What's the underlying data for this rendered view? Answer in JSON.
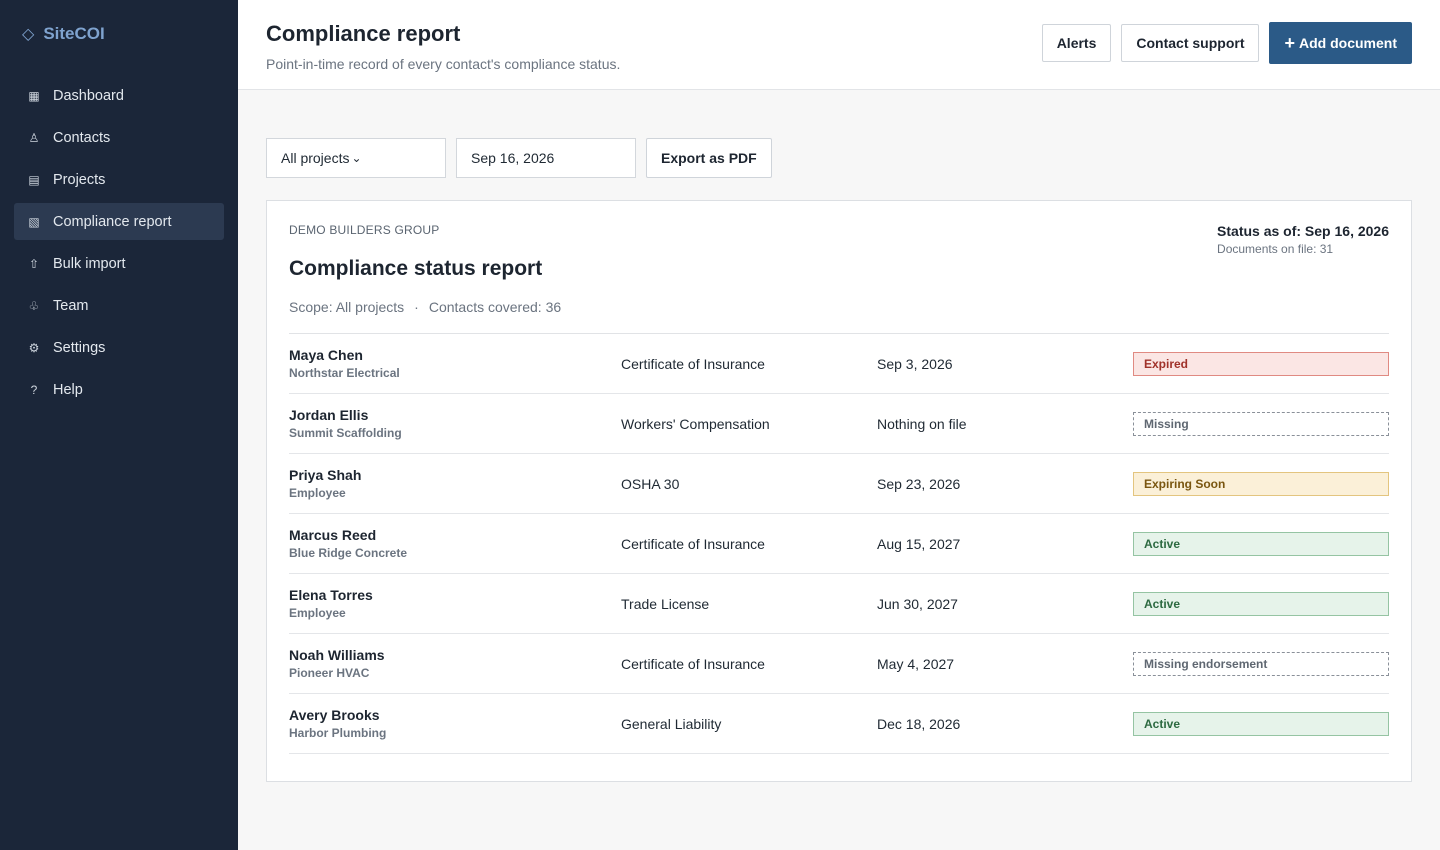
{
  "app": {
    "name": "SiteCOI",
    "logo_icon": "diamond-icon"
  },
  "sidebar": {
    "items": [
      {
        "label": "Dashboard",
        "icon": "grid-icon",
        "glyph": "▦",
        "active": false
      },
      {
        "label": "Contacts",
        "icon": "person-icon",
        "glyph": "♙",
        "active": false
      },
      {
        "label": "Projects",
        "icon": "list-icon",
        "glyph": "▤",
        "active": false
      },
      {
        "label": "Compliance report",
        "icon": "report-icon",
        "glyph": "▧",
        "active": true
      },
      {
        "label": "Bulk import",
        "icon": "upload-icon",
        "glyph": "⇧",
        "active": false
      },
      {
        "label": "Team",
        "icon": "team-icon",
        "glyph": "♧",
        "active": false
      },
      {
        "label": "Settings",
        "icon": "gear-icon",
        "glyph": "⚙",
        "active": false
      },
      {
        "label": "Help",
        "icon": "help-icon",
        "glyph": "?",
        "active": false
      }
    ]
  },
  "header": {
    "title": "Compliance report",
    "subtitle": "Point-in-time record of every contact's compliance status.",
    "alerts_label": "Alerts",
    "support_label": "Contact support",
    "add_label": "Add document"
  },
  "filters": {
    "project": "All projects",
    "date": "Sep 16, 2026",
    "export_label": "Export as PDF"
  },
  "report": {
    "org": "DEMO BUILDERS GROUP",
    "title": "Compliance status report",
    "status_as_of": "Status as of: Sep 16, 2026",
    "documents_on_file": "Documents on file: 31",
    "scope": "Scope: All projects",
    "separator": "·",
    "contacts_covered": "Contacts covered: 36",
    "rows": [
      {
        "name": "Maya Chen",
        "company": "Northstar Electrical",
        "document": "Certificate of Insurance",
        "date": "Sep 3, 2026",
        "status": "Expired",
        "status_kind": "expired"
      },
      {
        "name": "Jordan Ellis",
        "company": "Summit Scaffolding",
        "document": "Workers' Compensation",
        "date": "Nothing on file",
        "status": "Missing",
        "status_kind": "missing"
      },
      {
        "name": "Priya Shah",
        "company": "Employee",
        "document": "OSHA 30",
        "date": "Sep 23, 2026",
        "status": "Expiring Soon",
        "status_kind": "expiring"
      },
      {
        "name": "Marcus Reed",
        "company": "Blue Ridge Concrete",
        "document": "Certificate of Insurance",
        "date": "Aug 15, 2027",
        "status": "Active",
        "status_kind": "active"
      },
      {
        "name": "Elena Torres",
        "company": "Employee",
        "document": "Trade License",
        "date": "Jun 30, 2027",
        "status": "Active",
        "status_kind": "active"
      },
      {
        "name": "Noah Williams",
        "company": "Pioneer HVAC",
        "document": "Certificate of Insurance",
        "date": "May 4, 2027",
        "status": "Missing endorsement",
        "status_kind": "missing"
      },
      {
        "name": "Avery Brooks",
        "company": "Harbor Plumbing",
        "document": "General Liability",
        "date": "Dec 18, 2026",
        "status": "Active",
        "status_kind": "active"
      }
    ]
  },
  "colors": {
    "sidebar_bg": "#1b2639",
    "brand": "#7fa3cf",
    "primary": "#2b5a87",
    "expired": "#a0322a",
    "expiring": "#7a5610",
    "active": "#2d6a41"
  }
}
